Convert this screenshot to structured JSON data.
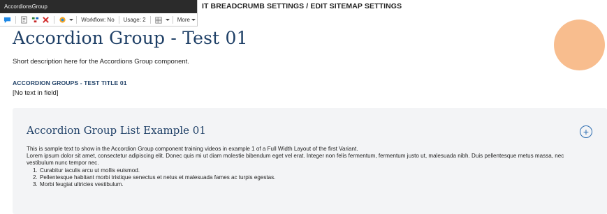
{
  "chrome": {
    "title": "AccordionsGroup",
    "workflow": "Workflow: No",
    "usage": "Usage: 2",
    "more": "More"
  },
  "top_links": "IT BREADCRUMB SETTINGS / EDIT SITEMAP SETTINGS",
  "page": {
    "title": "Accordion Group - Test 01",
    "description": "Short description here for the Accordions Group component.",
    "group_heading": "ACCORDION GROUPS - TEST TITLE 01",
    "empty_field": "[No text in field]"
  },
  "accordion": {
    "title": "Accordion Group List Example 01",
    "toggle": "+",
    "intro": "This is sample text to show in the Accordion Group component training videos in example 1 of a Full Width Layout of the first Variant.",
    "lorem": "Lorem ipsum dolor sit amet, consectetur adipiscing elit. Donec quis mi ut diam molestie bibendum eget vel erat. Integer non felis fermentum, fermentum justo ut, malesuada nibh. Duis pellentesque metus massa, nec vestibulum nunc tempor nec.",
    "items": [
      "Curabitur iaculis arcu ut mollis euismod.",
      "Pellentesque habitant morbi tristique senectus et netus et malesuada fames ac turpis egestas.",
      "Morbi feugiat ultricies vestibulum."
    ]
  },
  "colors": {
    "heading": "#1e3f66",
    "panel_bg": "#f3f4f6",
    "cursor_highlight": "#f7b27a",
    "toggle": "#2b6cb0"
  },
  "icons": [
    "chat-icon",
    "page-edit-icon",
    "component-icon",
    "delete-icon",
    "paint-icon",
    "caret-icon",
    "table-icon"
  ]
}
